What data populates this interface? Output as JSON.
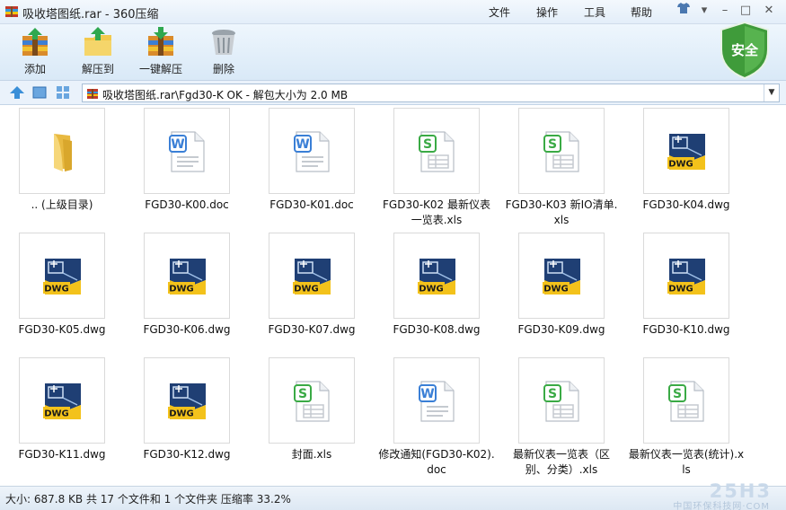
{
  "window": {
    "title": "吸收塔图纸.rar - 360压缩",
    "menus": [
      "文件",
      "操作",
      "工具",
      "帮助"
    ]
  },
  "toolbar": {
    "buttons": [
      {
        "label": "添加",
        "icon": "add-archive-icon"
      },
      {
        "label": "解压到",
        "icon": "extract-to-icon"
      },
      {
        "label": "一键解压",
        "icon": "one-click-extract-icon"
      },
      {
        "label": "删除",
        "icon": "trash-icon"
      }
    ],
    "security_label": "安全"
  },
  "address": {
    "path": "吸收塔图纸.rar\\Fgd30-K OK - 解包大小为 2.0 MB"
  },
  "files": [
    {
      "name": ".. (上级目录)",
      "type": "folder"
    },
    {
      "name": "FGD30-K00.doc",
      "type": "doc"
    },
    {
      "name": "FGD30-K01.doc",
      "type": "doc"
    },
    {
      "name": "FGD30-K02 最新仪表一览表.xls",
      "type": "xls"
    },
    {
      "name": "FGD30-K03 新IO清单.xls",
      "type": "xls"
    },
    {
      "name": "FGD30-K04.dwg",
      "type": "dwg"
    },
    {
      "name": "FGD30-K05.dwg",
      "type": "dwg"
    },
    {
      "name": "FGD30-K06.dwg",
      "type": "dwg"
    },
    {
      "name": "FGD30-K07.dwg",
      "type": "dwg"
    },
    {
      "name": "FGD30-K08.dwg",
      "type": "dwg"
    },
    {
      "name": "FGD30-K09.dwg",
      "type": "dwg"
    },
    {
      "name": "FGD30-K10.dwg",
      "type": "dwg"
    },
    {
      "name": "FGD30-K11.dwg",
      "type": "dwg"
    },
    {
      "name": "FGD30-K12.dwg",
      "type": "dwg"
    },
    {
      "name": "封面.xls",
      "type": "xls"
    },
    {
      "name": "修改通知(FGD30-K02).doc",
      "type": "doc"
    },
    {
      "name": "最新仪表一览表（区别、分类）.xls",
      "type": "xls"
    },
    {
      "name": "最新仪表一览表(统计).xls",
      "type": "xls"
    }
  ],
  "status": {
    "text": "大小: 687.8 KB 共 17 个文件和 1 个文件夹 压缩率 33.2%",
    "watermark_logo": "25H3",
    "watermark_sub": "中国环保科技网·COM"
  },
  "colors": {
    "doc": "#3a7fd6",
    "xls": "#3aaa45",
    "dwg_dark": "#1f3f74",
    "dwg_yellow": "#f3c21b",
    "shield": "#3f9b3a"
  }
}
